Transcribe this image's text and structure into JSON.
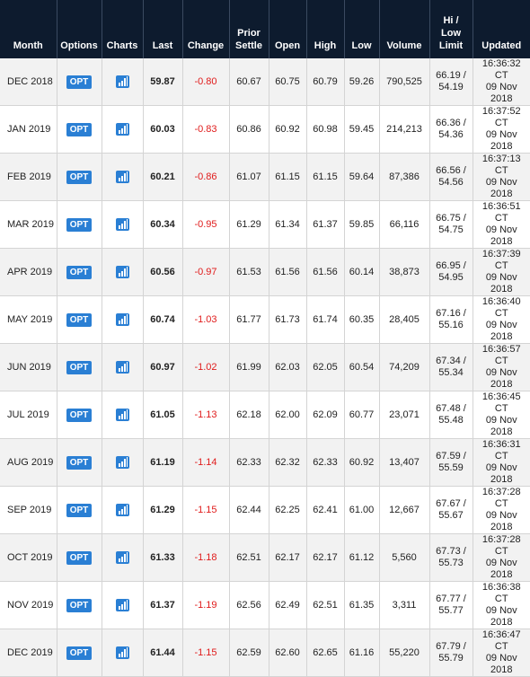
{
  "columns": {
    "month": "Month",
    "options": "Options",
    "charts": "Charts",
    "last": "Last",
    "change": "Change",
    "prior_settle": [
      "Prior",
      "Settle"
    ],
    "open": "Open",
    "high": "High",
    "low": "Low",
    "volume": "Volume",
    "hi_low_limit": [
      "Hi /",
      "Low",
      "Limit"
    ],
    "updated": "Updated"
  },
  "icons": {
    "chart": "bar-chart-icon"
  },
  "colors": {
    "header_bg": "#0d1b2e",
    "button_blue": "#2a7fd4",
    "negative": "#e01b1b"
  },
  "rows": [
    {
      "month": "DEC 2018",
      "opt": "OPT",
      "last": "59.87",
      "change": "-0.80",
      "prior": "60.67",
      "open": "60.75",
      "high": "60.79",
      "low": "59.26",
      "volume": "790,525",
      "hi": "66.19 /",
      "lo": "54.19",
      "time": "16:36:32 CT",
      "date": "09 Nov 2018"
    },
    {
      "month": "JAN 2019",
      "opt": "OPT",
      "last": "60.03",
      "change": "-0.83",
      "prior": "60.86",
      "open": "60.92",
      "high": "60.98",
      "low": "59.45",
      "volume": "214,213",
      "hi": "66.36 /",
      "lo": "54.36",
      "time": "16:37:52 CT",
      "date": "09 Nov 2018"
    },
    {
      "month": "FEB 2019",
      "opt": "OPT",
      "last": "60.21",
      "change": "-0.86",
      "prior": "61.07",
      "open": "61.15",
      "high": "61.15",
      "low": "59.64",
      "volume": "87,386",
      "hi": "66.56 /",
      "lo": "54.56",
      "time": "16:37:13 CT",
      "date": "09 Nov 2018"
    },
    {
      "month": "MAR 2019",
      "opt": "OPT",
      "last": "60.34",
      "change": "-0.95",
      "prior": "61.29",
      "open": "61.34",
      "high": "61.37",
      "low": "59.85",
      "volume": "66,116",
      "hi": "66.75 /",
      "lo": "54.75",
      "time": "16:36:51 CT",
      "date": "09 Nov 2018"
    },
    {
      "month": "APR 2019",
      "opt": "OPT",
      "last": "60.56",
      "change": "-0.97",
      "prior": "61.53",
      "open": "61.56",
      "high": "61.56",
      "low": "60.14",
      "volume": "38,873",
      "hi": "66.95 /",
      "lo": "54.95",
      "time": "16:37:39 CT",
      "date": "09 Nov 2018"
    },
    {
      "month": "MAY 2019",
      "opt": "OPT",
      "last": "60.74",
      "change": "-1.03",
      "prior": "61.77",
      "open": "61.73",
      "high": "61.74",
      "low": "60.35",
      "volume": "28,405",
      "hi": "67.16 /",
      "lo": "55.16",
      "time": "16:36:40 CT",
      "date": "09 Nov 2018"
    },
    {
      "month": "JUN 2019",
      "opt": "OPT",
      "last": "60.97",
      "change": "-1.02",
      "prior": "61.99",
      "open": "62.03",
      "high": "62.05",
      "low": "60.54",
      "volume": "74,209",
      "hi": "67.34 /",
      "lo": "55.34",
      "time": "16:36:57 CT",
      "date": "09 Nov 2018"
    },
    {
      "month": "JUL 2019",
      "opt": "OPT",
      "last": "61.05",
      "change": "-1.13",
      "prior": "62.18",
      "open": "62.00",
      "high": "62.09",
      "low": "60.77",
      "volume": "23,071",
      "hi": "67.48 /",
      "lo": "55.48",
      "time": "16:36:45 CT",
      "date": "09 Nov 2018"
    },
    {
      "month": "AUG 2019",
      "opt": "OPT",
      "last": "61.19",
      "change": "-1.14",
      "prior": "62.33",
      "open": "62.32",
      "high": "62.33",
      "low": "60.92",
      "volume": "13,407",
      "hi": "67.59 /",
      "lo": "55.59",
      "time": "16:36:31 CT",
      "date": "09 Nov 2018"
    },
    {
      "month": "SEP 2019",
      "opt": "OPT",
      "last": "61.29",
      "change": "-1.15",
      "prior": "62.44",
      "open": "62.25",
      "high": "62.41",
      "low": "61.00",
      "volume": "12,667",
      "hi": "67.67 /",
      "lo": "55.67",
      "time": "16:37:28 CT",
      "date": "09 Nov 2018"
    },
    {
      "month": "OCT 2019",
      "opt": "OPT",
      "last": "61.33",
      "change": "-1.18",
      "prior": "62.51",
      "open": "62.17",
      "high": "62.17",
      "low": "61.12",
      "volume": "5,560",
      "hi": "67.73 /",
      "lo": "55.73",
      "time": "16:37:28 CT",
      "date": "09 Nov 2018"
    },
    {
      "month": "NOV 2019",
      "opt": "OPT",
      "last": "61.37",
      "change": "-1.19",
      "prior": "62.56",
      "open": "62.49",
      "high": "62.51",
      "low": "61.35",
      "volume": "3,311",
      "hi": "67.77 /",
      "lo": "55.77",
      "time": "16:36:38 CT",
      "date": "09 Nov 2018"
    },
    {
      "month": "DEC 2019",
      "opt": "OPT",
      "last": "61.44",
      "change": "-1.15",
      "prior": "62.59",
      "open": "62.60",
      "high": "62.65",
      "low": "61.16",
      "volume": "55,220",
      "hi": "67.79 /",
      "lo": "55.79",
      "time": "16:36:47 CT",
      "date": "09 Nov 2018"
    }
  ]
}
